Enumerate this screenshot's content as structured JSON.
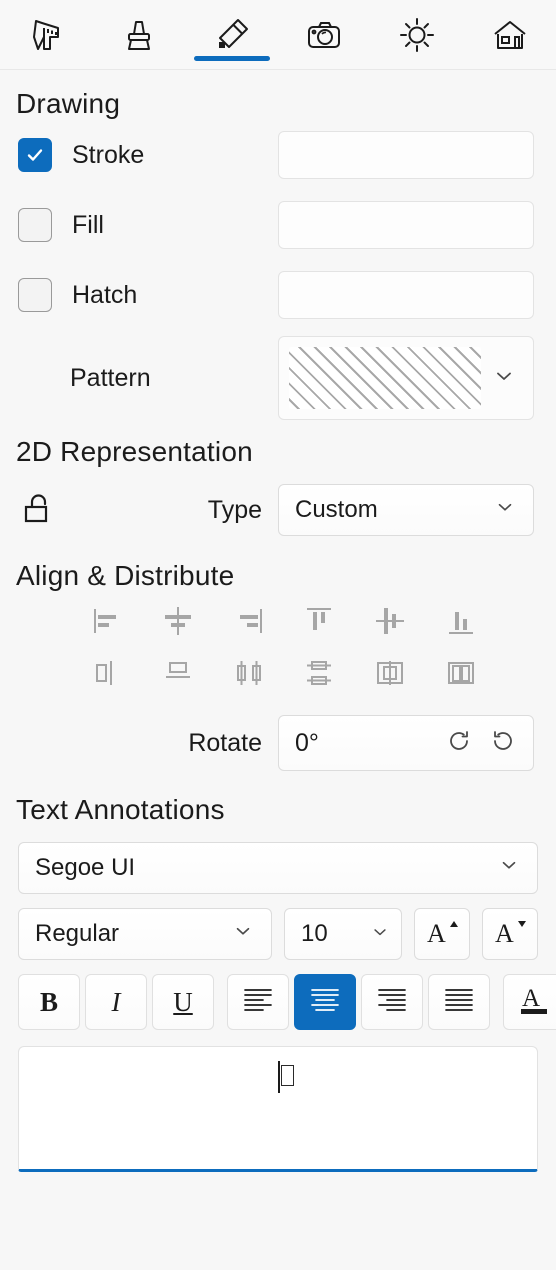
{
  "toolbar": {
    "tabs": [
      {
        "name": "measure-tool",
        "icon": "caliper-icon",
        "active": false
      },
      {
        "name": "paintbrush-tool",
        "icon": "brush-icon",
        "active": false
      },
      {
        "name": "markup-tool",
        "icon": "pencil-icon",
        "active": true
      },
      {
        "name": "camera-tool",
        "icon": "camera-icon",
        "active": false
      },
      {
        "name": "lighting-tool",
        "icon": "sun-icon",
        "active": false
      },
      {
        "name": "home-tool",
        "icon": "house-icon",
        "active": false
      }
    ]
  },
  "drawing": {
    "title": "Drawing",
    "stroke": {
      "label": "Stroke",
      "checked": true,
      "color": "#808080"
    },
    "fill": {
      "label": "Fill",
      "checked": false,
      "color": "#c0c0c0"
    },
    "hatch": {
      "label": "Hatch",
      "checked": false,
      "color": "#525252"
    },
    "pattern": {
      "label": "Pattern",
      "value": "diagonal-lines"
    }
  },
  "representation": {
    "title": "2D Representation",
    "lock_state": "unlocked",
    "type_label": "Type",
    "type_value": "Custom",
    "type_options": [
      "Custom"
    ]
  },
  "align": {
    "title": "Align & Distribute",
    "buttons": [
      {
        "name": "align-left-icon"
      },
      {
        "name": "align-center-horizontal-icon"
      },
      {
        "name": "align-right-icon"
      },
      {
        "name": "align-top-icon"
      },
      {
        "name": "align-center-vertical-icon"
      },
      {
        "name": "align-bottom-icon"
      },
      {
        "name": "distribute-horizontal-left-icon"
      },
      {
        "name": "distribute-vertical-top-icon"
      },
      {
        "name": "distribute-horizontal-center-icon"
      },
      {
        "name": "distribute-vertical-center-icon"
      },
      {
        "name": "distribute-horizontal-space-icon"
      },
      {
        "name": "distribute-vertical-space-icon"
      }
    ],
    "rotate_label": "Rotate",
    "rotate_value": "0°",
    "rotate_cw": "rotate-clockwise-icon",
    "rotate_ccw": "rotate-counterclockwise-icon"
  },
  "text": {
    "title": "Text Annotations",
    "font_family": "Segoe UI",
    "font_style": "Regular",
    "font_size": "10",
    "grow_font": "A",
    "shrink_font": "A",
    "bold": "B",
    "italic": "I",
    "underline": "U",
    "align_left": "align-left-icon",
    "align_center": "align-center-icon",
    "align_right": "align-right-icon",
    "align_justify": "align-justify-icon",
    "font_color": "A",
    "alignment_active": "center",
    "annotation_value": ""
  },
  "colors": {
    "accent": "#0d6cbd",
    "panel_bg": "#f7f7f7",
    "icon_gray": "#a6a6a6",
    "text": "#1b1b1b"
  }
}
